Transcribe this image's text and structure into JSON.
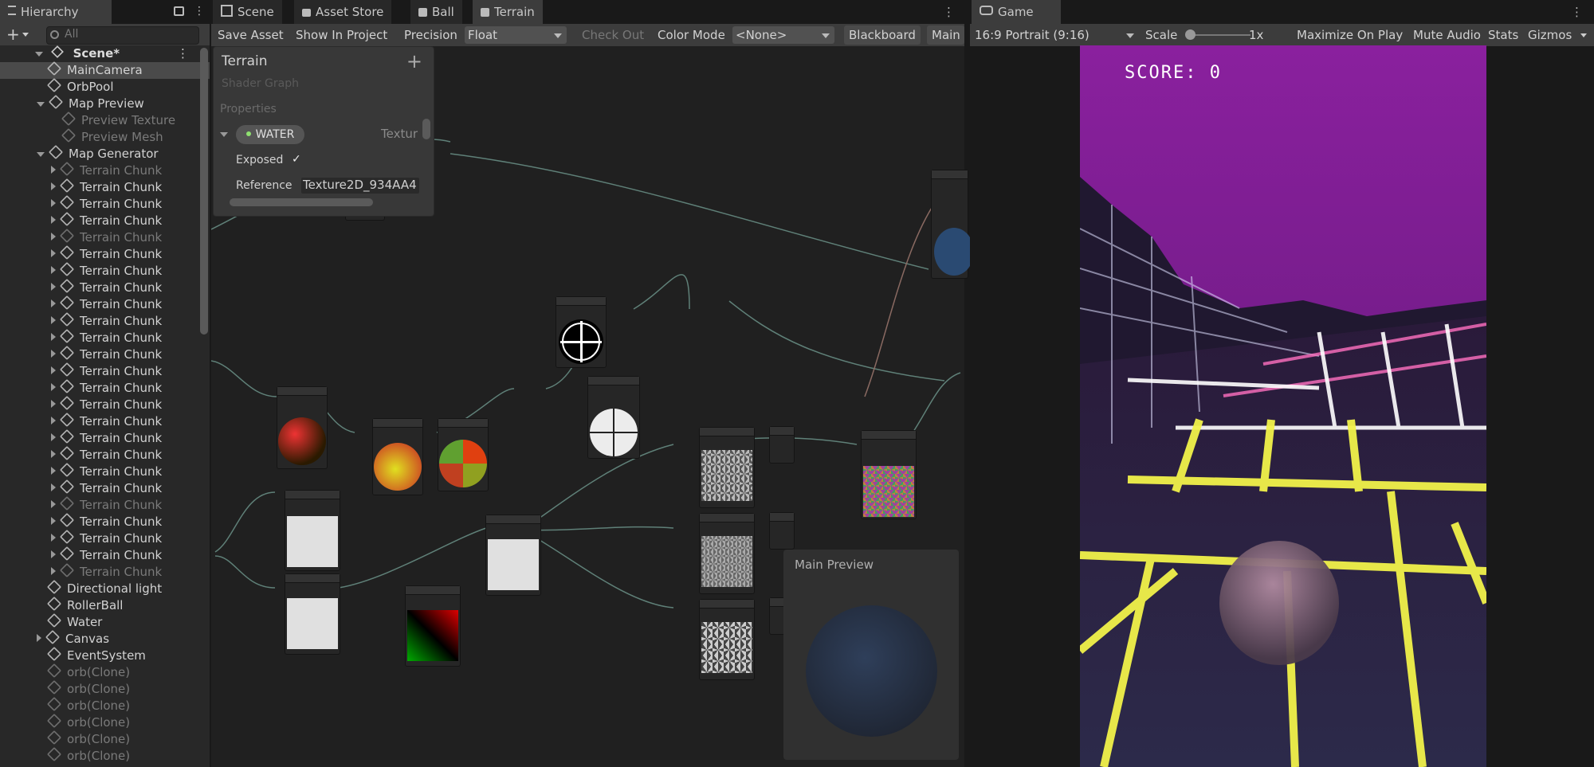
{
  "hierarchy": {
    "tab_label": "Hierarchy",
    "search_placeholder": "All",
    "scene": "Scene*",
    "items": [
      {
        "label": "MainCamera",
        "faded": false,
        "arrow": "",
        "indent": 2,
        "selected": true
      },
      {
        "label": "OrbPool",
        "faded": false,
        "arrow": "",
        "indent": 2
      },
      {
        "label": "Map Preview",
        "faded": false,
        "arrow": "down",
        "indent": 2
      },
      {
        "label": "Preview Texture",
        "faded": true,
        "arrow": "",
        "indent": 3
      },
      {
        "label": "Preview Mesh",
        "faded": true,
        "arrow": "",
        "indent": 3
      },
      {
        "label": "Map Generator",
        "faded": false,
        "arrow": "down",
        "indent": 2
      },
      {
        "label": "Terrain Chunk",
        "faded": true,
        "arrow": "right",
        "indent": 3
      },
      {
        "label": "Terrain Chunk",
        "faded": false,
        "arrow": "right",
        "indent": 3
      },
      {
        "label": "Terrain Chunk",
        "faded": false,
        "arrow": "right",
        "indent": 3
      },
      {
        "label": "Terrain Chunk",
        "faded": false,
        "arrow": "right",
        "indent": 3
      },
      {
        "label": "Terrain Chunk",
        "faded": true,
        "arrow": "right",
        "indent": 3
      },
      {
        "label": "Terrain Chunk",
        "faded": false,
        "arrow": "right",
        "indent": 3
      },
      {
        "label": "Terrain Chunk",
        "faded": false,
        "arrow": "right",
        "indent": 3
      },
      {
        "label": "Terrain Chunk",
        "faded": false,
        "arrow": "right",
        "indent": 3
      },
      {
        "label": "Terrain Chunk",
        "faded": false,
        "arrow": "right",
        "indent": 3
      },
      {
        "label": "Terrain Chunk",
        "faded": false,
        "arrow": "right",
        "indent": 3
      },
      {
        "label": "Terrain Chunk",
        "faded": false,
        "arrow": "right",
        "indent": 3
      },
      {
        "label": "Terrain Chunk",
        "faded": false,
        "arrow": "right",
        "indent": 3
      },
      {
        "label": "Terrain Chunk",
        "faded": false,
        "arrow": "right",
        "indent": 3
      },
      {
        "label": "Terrain Chunk",
        "faded": false,
        "arrow": "right",
        "indent": 3
      },
      {
        "label": "Terrain Chunk",
        "faded": false,
        "arrow": "right",
        "indent": 3
      },
      {
        "label": "Terrain Chunk",
        "faded": false,
        "arrow": "right",
        "indent": 3
      },
      {
        "label": "Terrain Chunk",
        "faded": false,
        "arrow": "right",
        "indent": 3
      },
      {
        "label": "Terrain Chunk",
        "faded": false,
        "arrow": "right",
        "indent": 3
      },
      {
        "label": "Terrain Chunk",
        "faded": false,
        "arrow": "right",
        "indent": 3
      },
      {
        "label": "Terrain Chunk",
        "faded": false,
        "arrow": "right",
        "indent": 3
      },
      {
        "label": "Terrain Chunk",
        "faded": true,
        "arrow": "right",
        "indent": 3
      },
      {
        "label": "Terrain Chunk",
        "faded": false,
        "arrow": "right",
        "indent": 3
      },
      {
        "label": "Terrain Chunk",
        "faded": false,
        "arrow": "right",
        "indent": 3
      },
      {
        "label": "Terrain Chunk",
        "faded": false,
        "arrow": "right",
        "indent": 3
      },
      {
        "label": "Terrain Chunk",
        "faded": true,
        "arrow": "right",
        "indent": 3
      },
      {
        "label": "Directional light",
        "faded": false,
        "arrow": "",
        "indent": 2
      },
      {
        "label": "RollerBall",
        "faded": false,
        "arrow": "",
        "indent": 2
      },
      {
        "label": "Water",
        "faded": false,
        "arrow": "",
        "indent": 2
      },
      {
        "label": "Canvas",
        "faded": false,
        "arrow": "right",
        "indent": 2
      },
      {
        "label": "EventSystem",
        "faded": false,
        "arrow": "",
        "indent": 2
      },
      {
        "label": "orb(Clone)",
        "faded": true,
        "arrow": "",
        "indent": 2
      },
      {
        "label": "orb(Clone)",
        "faded": true,
        "arrow": "",
        "indent": 2
      },
      {
        "label": "orb(Clone)",
        "faded": true,
        "arrow": "",
        "indent": 2
      },
      {
        "label": "orb(Clone)",
        "faded": true,
        "arrow": "",
        "indent": 2
      },
      {
        "label": "orb(Clone)",
        "faded": true,
        "arrow": "",
        "indent": 2
      },
      {
        "label": "orb(Clone)",
        "faded": true,
        "arrow": "",
        "indent": 2
      }
    ]
  },
  "center_tabs": [
    "Scene",
    "Asset Store",
    "Ball",
    "Terrain"
  ],
  "shader_toolbar": {
    "save_asset": "Save Asset",
    "show_in_project": "Show In Project",
    "precision_label": "Precision",
    "precision_value": "Float",
    "check_out": "Check Out",
    "color_mode_label": "Color Mode",
    "color_mode_value": "<None>",
    "blackboard": "Blackboard",
    "main_preview_btn": "Main P"
  },
  "blackboard": {
    "title": "Terrain",
    "subtitle": "Shader Graph",
    "properties_label": "Properties",
    "property_name": "WATER",
    "property_type": "Textur",
    "exposed_label": "Exposed",
    "reference_label": "Reference",
    "reference_value": "Texture2D_934AA4"
  },
  "main_preview": {
    "title": "Main Preview"
  },
  "game": {
    "tab_label": "Game",
    "aspect": "16:9 Portrait (9:16)",
    "scale_label": "Scale",
    "scale_value": "1x",
    "maximize": "Maximize On Play",
    "mute": "Mute Audio",
    "stats": "Stats",
    "gizmos": "Gizmos",
    "score_text": "SCORE: 0"
  },
  "colors": {
    "accent_sky": "#7a1e9c",
    "grid_glow": "#f2f24a",
    "panel_bg": "#282828"
  }
}
